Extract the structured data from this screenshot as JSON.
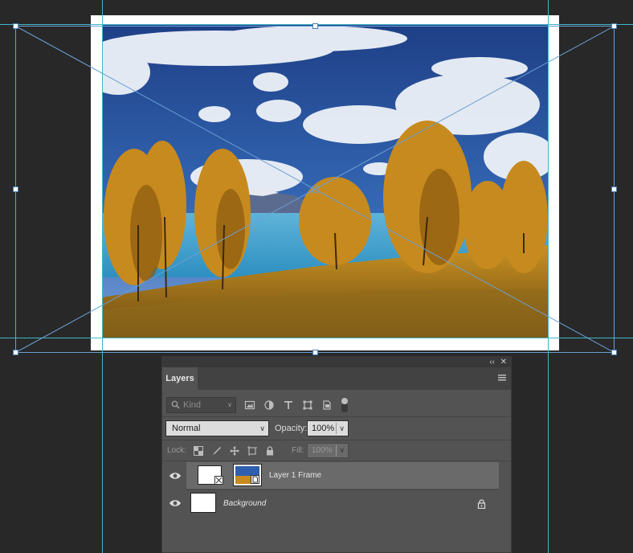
{
  "canvas": {
    "photo_subject": "autumn trees by a blue lake under cloudy sky",
    "colors": {
      "paper": "#ffffff",
      "guide": "#3fb6c6",
      "transform": "#6a9fd6"
    }
  },
  "layers_panel": {
    "tab_label": "Layers",
    "collapse_icon": "double-chevron-left",
    "close_icon": "close-x",
    "filter": {
      "kind_placeholder": "Kind"
    },
    "blend_mode": "Normal",
    "opacity_label": "Opacity:",
    "opacity_value": "100%",
    "lock_label": "Lock:",
    "fill_label": "Fill:",
    "fill_value": "100%",
    "layers": [
      {
        "name": "Layer 1 Frame",
        "visible": true,
        "selected": true
      },
      {
        "name": "Background",
        "visible": true,
        "locked": true,
        "italic": true
      }
    ]
  }
}
